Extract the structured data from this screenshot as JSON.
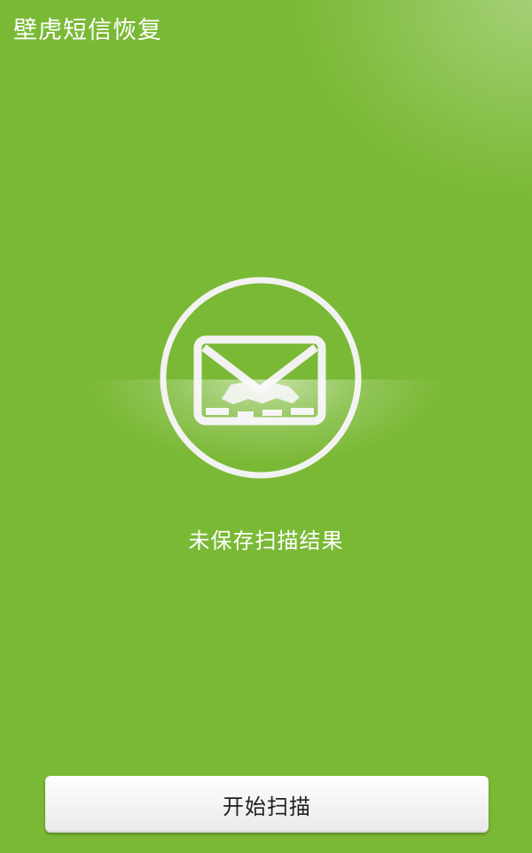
{
  "app": {
    "title": "壁虎短信恢复"
  },
  "main": {
    "icon": "mail-envelope-icon",
    "status_text": "未保存扫描结果"
  },
  "actions": {
    "start_scan_label": "开始扫描"
  },
  "colors": {
    "background": "#7ab935",
    "text": "#ffffff",
    "button_text": "#222222",
    "button_background": "#f2f2f2"
  }
}
